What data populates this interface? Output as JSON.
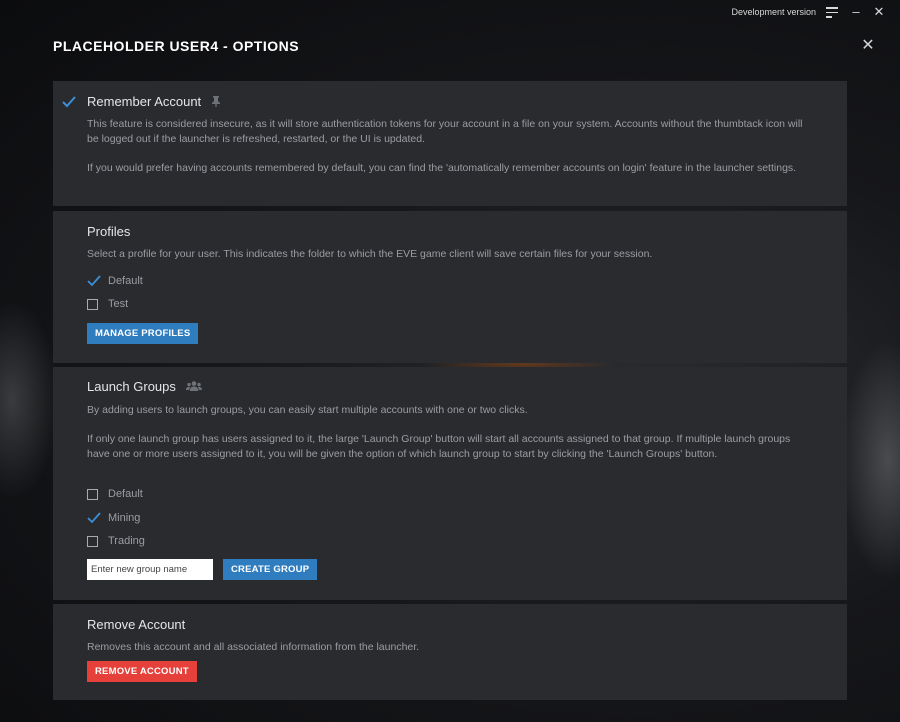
{
  "window": {
    "dev_label": "Development version",
    "menu_icon": "menu-icon",
    "minimize_icon": "minimize-icon",
    "close_icon": "close-icon"
  },
  "page": {
    "title": "PLACEHOLDER USER4 - OPTIONS",
    "close_icon": "close-icon"
  },
  "remember": {
    "heading": "Remember Account",
    "checked": true,
    "pin_icon": "pin-icon",
    "text1": "This feature is considered insecure, as it will store authentication tokens for your account in a file on your system. Accounts without the thumbtack icon will be logged out if the launcher is refreshed, restarted, or the UI is updated.",
    "text2": "If you would prefer having accounts remembered by default, you can find the 'automatically remember accounts on login' feature in the launcher settings."
  },
  "profiles": {
    "heading": "Profiles",
    "text": "Select a profile for your user. This indicates the folder to which the EVE game client will save certain files for your session.",
    "options": [
      {
        "label": "Default",
        "checked": true
      },
      {
        "label": "Test",
        "checked": false
      }
    ],
    "manage_label": "MANAGE PROFILES"
  },
  "launch_groups": {
    "heading": "Launch Groups",
    "group_icon": "users-icon",
    "text1": "By adding users to launch groups, you can easily start multiple accounts with one or two clicks.",
    "text2": "If only one launch group has users assigned to it, the large 'Launch Group' button will start all accounts assigned to that group. If multiple launch groups have one or more users assigned to it, you will be given the option of which launch group to start by clicking the 'Launch Groups' button.",
    "options": [
      {
        "label": "Default",
        "checked": false
      },
      {
        "label": "Mining",
        "checked": true
      },
      {
        "label": "Trading",
        "checked": false
      }
    ],
    "input_placeholder": "Enter new group name",
    "create_label": "CREATE GROUP"
  },
  "remove": {
    "heading": "Remove Account",
    "text": "Removes this account and all associated information from the launcher.",
    "button_label": "REMOVE ACCOUNT"
  },
  "colors": {
    "accent": "#2f7dbf",
    "danger": "#e5403a",
    "panel": "#2a2b2f"
  }
}
